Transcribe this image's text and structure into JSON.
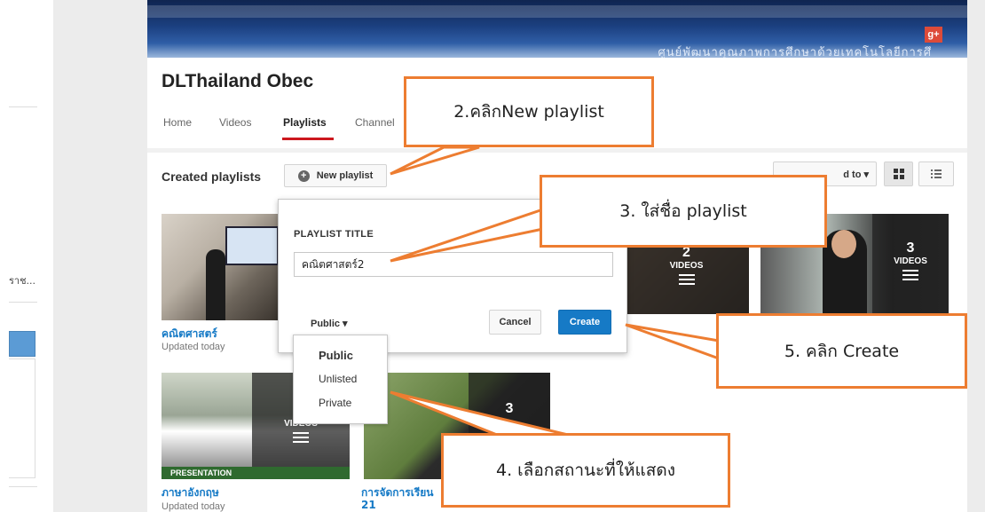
{
  "sidebar": {
    "truncated_item": "ราช..."
  },
  "banner": {
    "gplus": "g+",
    "subtitle": "ศูนย์พัฒนาคุณภาพการศึกษาด้วยเทคโนโลยีการศึ"
  },
  "channel": {
    "title": "DLThailand Obec"
  },
  "tabs": [
    {
      "label": "Home"
    },
    {
      "label": "Videos"
    },
    {
      "label": "Playlists"
    },
    {
      "label": "Channel"
    }
  ],
  "toolbar": {
    "section_title": "Created playlists",
    "new_playlist_label": "New playlist",
    "sort_label": "d to ▾"
  },
  "popup": {
    "label": "PLAYLIST TITLE",
    "input_value": "คณิตศาสตร์2",
    "privacy_label": "Public ▾",
    "cancel_label": "Cancel",
    "create_label": "Create"
  },
  "privacy_options": [
    "Public",
    "Unlisted",
    "Private"
  ],
  "playlists": [
    {
      "title": "คณิตศาสตร์",
      "updated": "Updated today"
    },
    {
      "count": "2",
      "videos_label": "VIDEOS"
    },
    {
      "count": "3",
      "videos_label": "VIDEOS"
    },
    {
      "title": "ภาษาอังกฤษ",
      "updated": "Updated today",
      "videos_label": "VIDEOS"
    },
    {
      "title": "การจัดการเรียน",
      "updated": "21",
      "count": "3"
    }
  ],
  "callouts": {
    "step2": "2.คลิกNew playlist",
    "step3": "3. ใส่ชื่อ playlist",
    "step4": "4. เลือกสถานะที่ให้แสดง",
    "step5": "5. คลิก Create"
  },
  "colors": {
    "accent_orange": "#ed7d31",
    "create_blue": "#167ac6",
    "tab_red": "#cc181e",
    "link_blue": "#167ac6"
  }
}
